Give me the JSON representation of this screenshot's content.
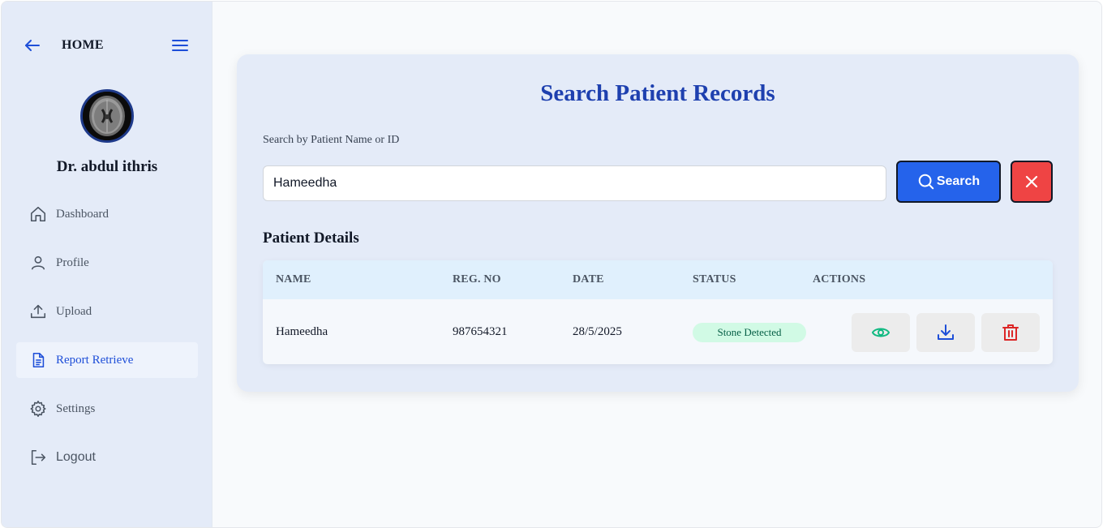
{
  "header": {
    "home_label": "HOME"
  },
  "profile": {
    "doctor_name": "Dr. abdul ithris"
  },
  "sidebar": {
    "items": [
      {
        "label": "Dashboard",
        "icon": "home-icon"
      },
      {
        "label": "Profile",
        "icon": "user-icon"
      },
      {
        "label": "Upload",
        "icon": "upload-icon"
      },
      {
        "label": "Report Retrieve",
        "icon": "document-icon",
        "active": true
      },
      {
        "label": "Settings",
        "icon": "gear-icon"
      },
      {
        "label": "Logout",
        "icon": "logout-icon"
      }
    ]
  },
  "main": {
    "title": "Search Patient Records",
    "search_label": "Search by Patient Name or ID",
    "search_value": "Hameedha",
    "search_button": "Search",
    "section_title": "Patient Details",
    "table": {
      "columns": [
        "NAME",
        "REG. NO",
        "DATE",
        "STATUS",
        "ACTIONS"
      ],
      "rows": [
        {
          "name": "Hameedha",
          "reg_no": "987654321",
          "date": "28/5/2025",
          "status": "Stone Detected"
        }
      ]
    }
  },
  "colors": {
    "accent": "#2563eb",
    "title": "#1e40af",
    "danger": "#ef4444",
    "success_bg": "#d1fae5",
    "view_icon": "#10b981"
  }
}
